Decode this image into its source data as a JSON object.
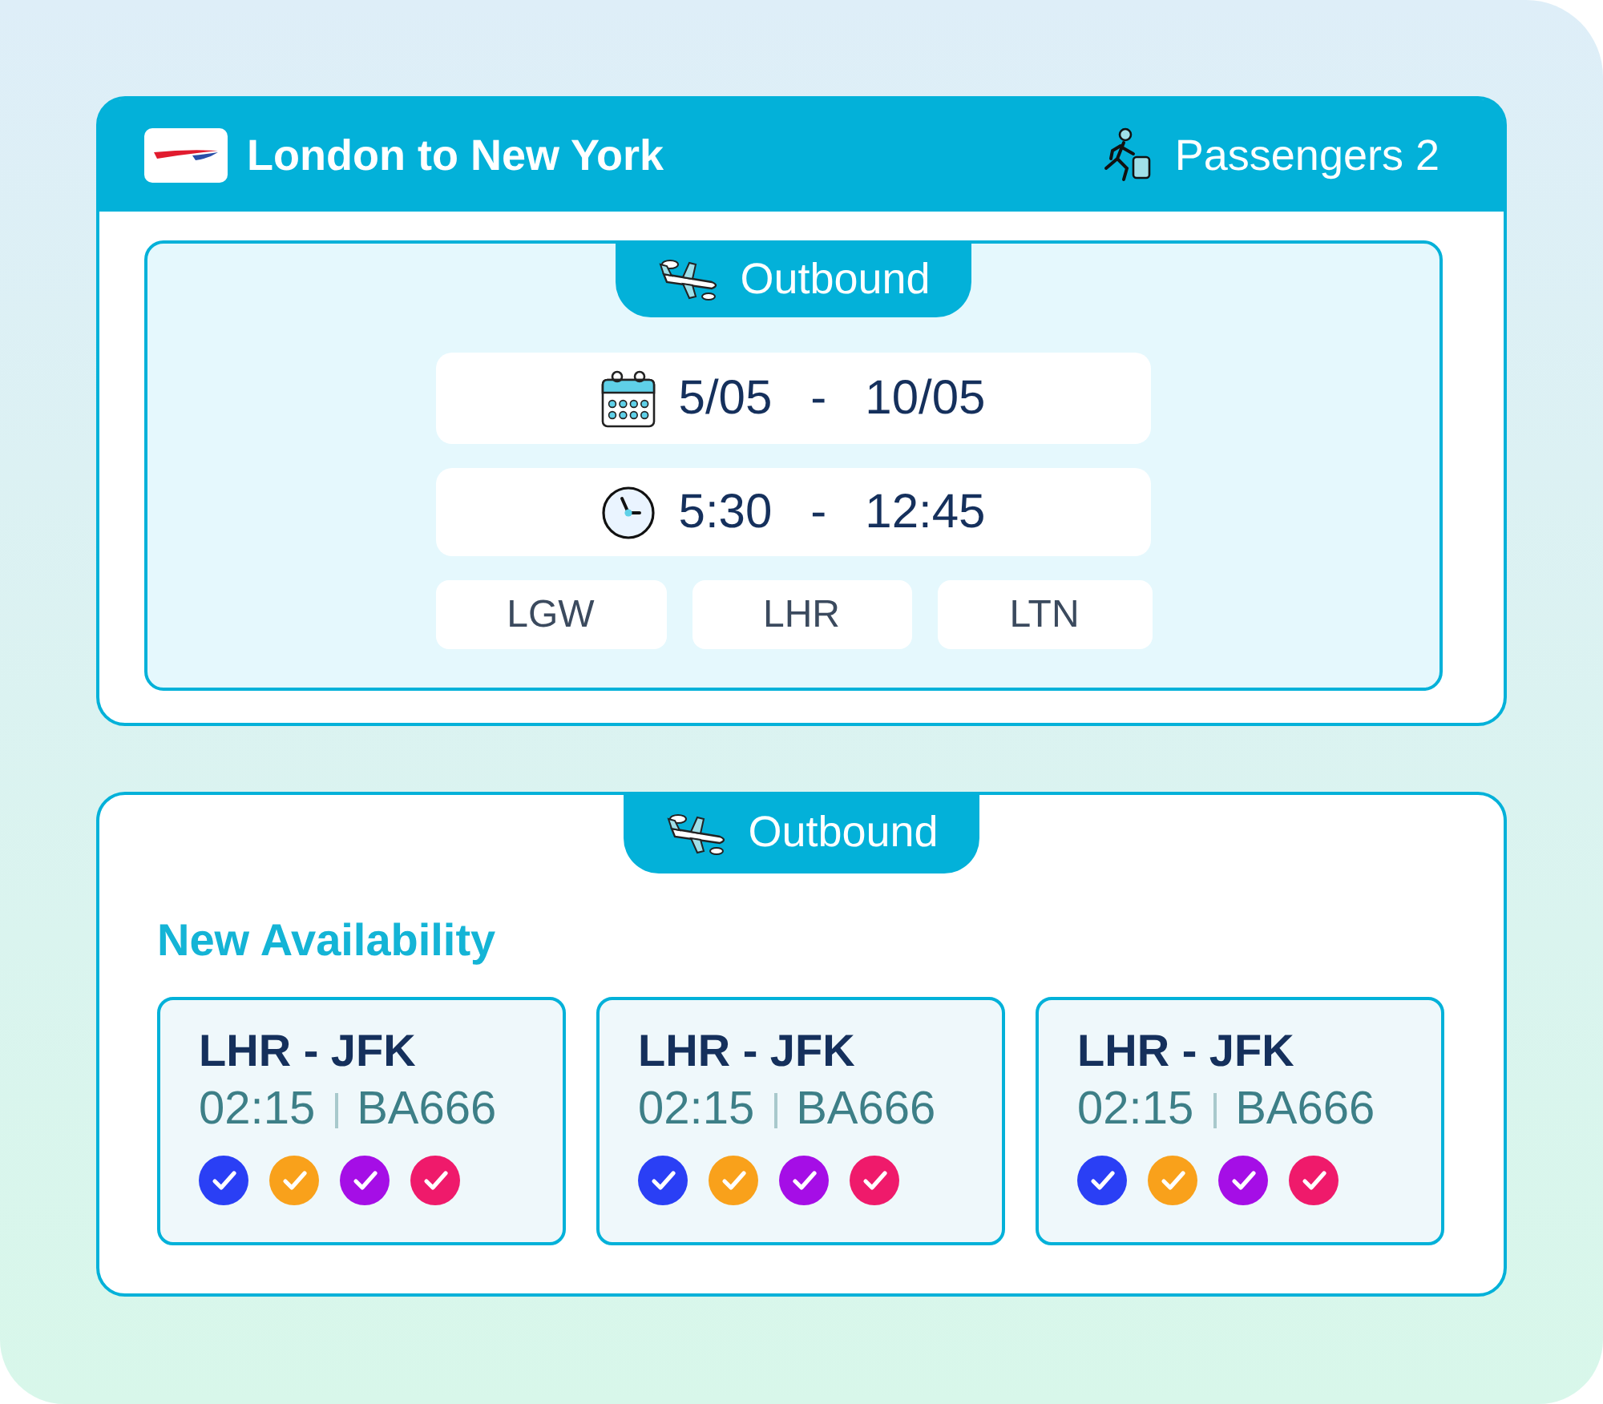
{
  "header": {
    "title": "London to New York",
    "passengers": "Passengers 2"
  },
  "search": {
    "tab": "Outbound",
    "dates": {
      "from": "5/05",
      "separator": "-",
      "to": "10/05"
    },
    "times": {
      "from": "5:30",
      "separator": "-",
      "to": "12:45"
    },
    "airports": [
      "LGW",
      "LHR",
      "LTN"
    ]
  },
  "results": {
    "tab": "Outbound",
    "heading": "New Availability",
    "flights": [
      {
        "route": "LHR - JFK",
        "duration": "02:15",
        "flight": "BA666",
        "checks": [
          {
            "color": "#2a3ff5"
          },
          {
            "color": "#f9a11b"
          },
          {
            "color": "#a50ee6"
          },
          {
            "color": "#ef1a6b"
          }
        ]
      },
      {
        "route": "LHR - JFK",
        "duration": "02:15",
        "flight": "BA666",
        "checks": [
          {
            "color": "#2a3ff5"
          },
          {
            "color": "#f9a11b"
          },
          {
            "color": "#a50ee6"
          },
          {
            "color": "#ef1a6b"
          }
        ]
      },
      {
        "route": "LHR - JFK",
        "duration": "02:15",
        "flight": "BA666",
        "checks": [
          {
            "color": "#2a3ff5"
          },
          {
            "color": "#f9a11b"
          },
          {
            "color": "#a50ee6"
          },
          {
            "color": "#ef1a6b"
          }
        ]
      }
    ]
  }
}
